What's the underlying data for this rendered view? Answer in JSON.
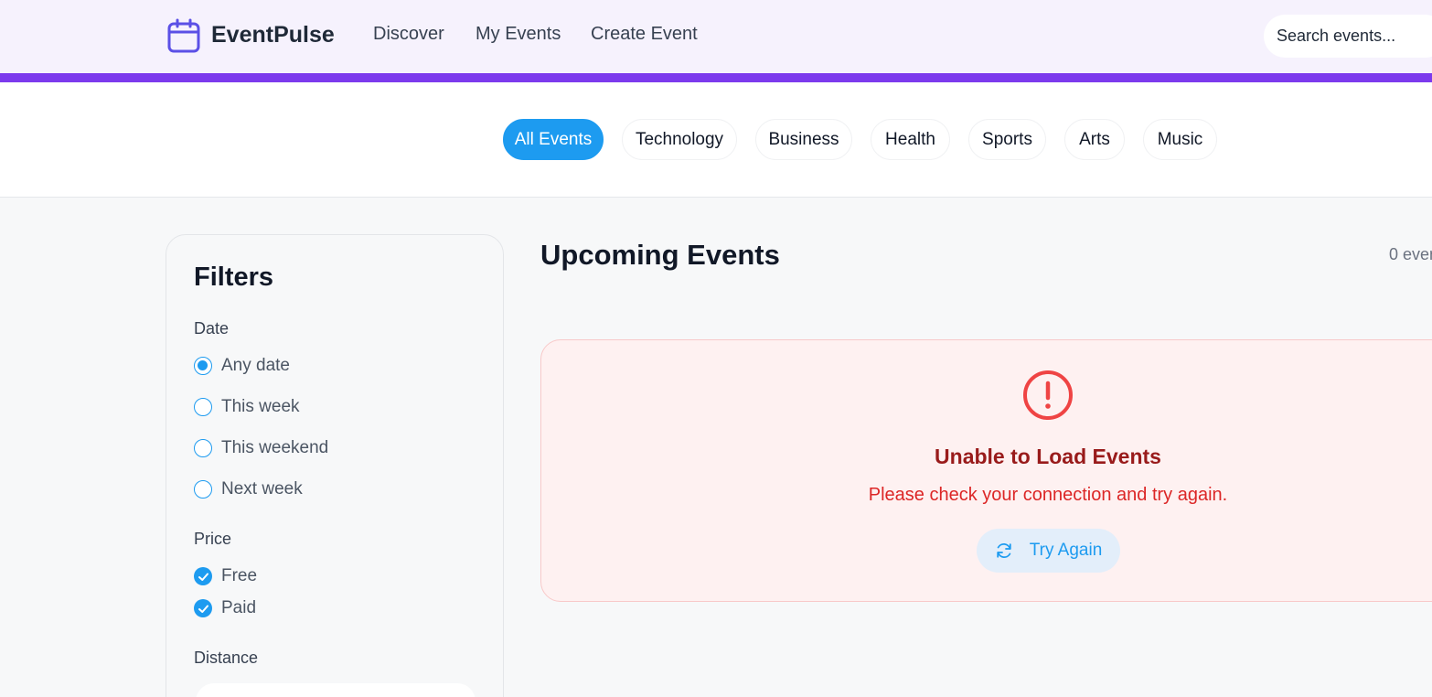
{
  "header": {
    "brand": "EventPulse",
    "nav": [
      "Discover",
      "My Events",
      "Create Event"
    ],
    "search_placeholder": "Search events..."
  },
  "categories": [
    "All Events",
    "Technology",
    "Business",
    "Health",
    "Sports",
    "Arts",
    "Music"
  ],
  "active_category": "All Events",
  "filters": {
    "title": "Filters",
    "date": {
      "label": "Date",
      "options": [
        "Any date",
        "This week",
        "This weekend",
        "Next week"
      ],
      "selected": "Any date"
    },
    "price": {
      "label": "Price",
      "options": [
        "Free",
        "Paid"
      ],
      "checked": [
        "Free",
        "Paid"
      ]
    },
    "distance": {
      "label": "Distance"
    }
  },
  "main": {
    "title": "Upcoming Events",
    "count": "0 even"
  },
  "error": {
    "title": "Unable to Load Events",
    "message": "Please check your connection and try again.",
    "retry_label": "Try Again"
  },
  "colors": {
    "accent": "#1d9bf0",
    "brand_purple": "#7c3aed",
    "logo_icon": "#5b50e6",
    "error_title": "#991b1b",
    "error_text": "#dc2626",
    "error_bg": "#fef1f1"
  }
}
